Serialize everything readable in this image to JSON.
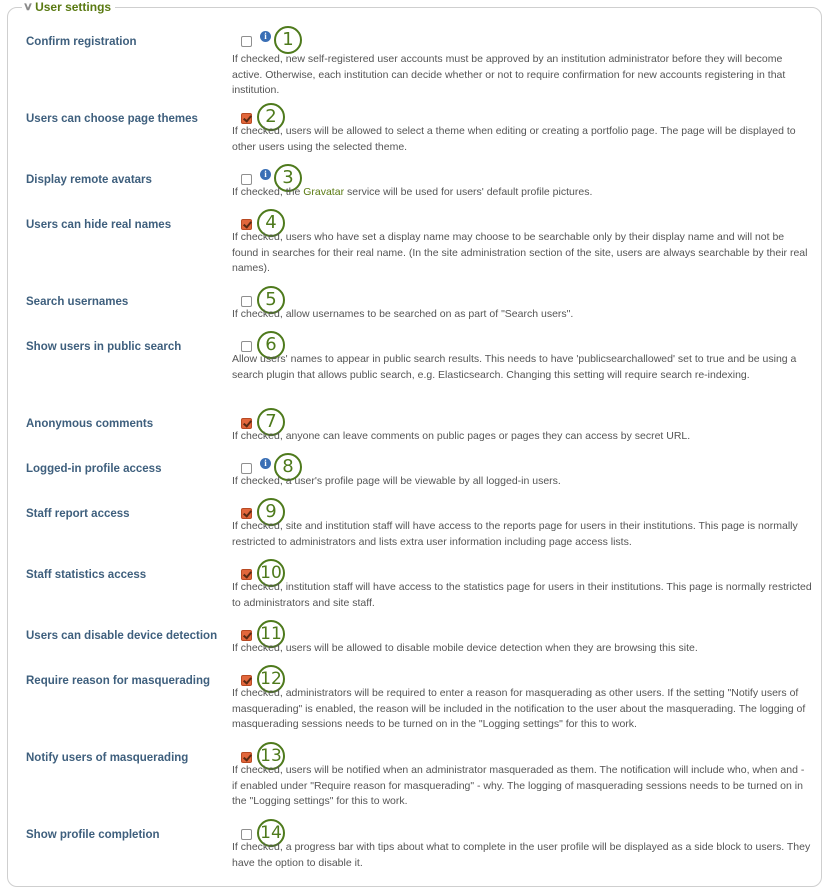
{
  "section": {
    "title": "User settings",
    "collapse_icon": "chevron-down-icon"
  },
  "settings": [
    {
      "label": "Confirm registration",
      "checked": false,
      "info": true,
      "callout": "1",
      "description": "If checked, new self-registered user accounts must be approved by an institution administrator before they will become active. Otherwise, each institution can decide whether or not to require confirmation for new accounts registering in that institution."
    },
    {
      "label": "Users can choose page themes",
      "checked": true,
      "info": false,
      "callout": "2",
      "description": "If checked, users will be allowed to select a theme when editing or creating a portfolio page. The page will be displayed to other users using the selected theme."
    },
    {
      "label": "Display remote avatars",
      "checked": false,
      "info": true,
      "callout": "3",
      "description_pre": "If checked, the ",
      "description_link": "Gravatar",
      "description_post": " service will be used for users' default profile pictures."
    },
    {
      "label": "Users can hide real names",
      "checked": true,
      "info": false,
      "callout": "4",
      "description": "If checked, users who have set a display name may choose to be searchable only by their display name and will not be found in searches for their real name. (In the site administration section of the site, users are always searchable by their real names)."
    },
    {
      "label": "Search usernames",
      "checked": false,
      "info": false,
      "callout": "5",
      "description": "If checked, allow usernames to be searched on as part of \"Search users\"."
    },
    {
      "label": "Show users in public search",
      "checked": false,
      "info": false,
      "callout": "6",
      "description": "Allow users' names to appear in public search results. This needs to have 'publicsearchallowed' set to true and be using a search plugin that allows public search, e.g. Elasticsearch. Changing this setting will require search re-indexing."
    },
    {
      "label": "Anonymous comments",
      "checked": true,
      "info": false,
      "callout": "7",
      "description": "If checked, anyone can leave comments on public pages or pages they can access by secret URL."
    },
    {
      "label": "Logged-in profile access",
      "checked": false,
      "info": true,
      "callout": "8",
      "description": "If checked, a user's profile page will be viewable by all logged-in users."
    },
    {
      "label": "Staff report access",
      "checked": true,
      "info": false,
      "callout": "9",
      "description": "If checked, site and institution staff will have access to the reports page for users in their institutions. This page is normally restricted to administrators and lists extra user information including page access lists."
    },
    {
      "label": "Staff statistics access",
      "checked": true,
      "info": false,
      "callout": "10",
      "description": "If checked, institution staff will have access to the statistics page for users in their institutions. This page is normally restricted to administrators and site staff."
    },
    {
      "label": "Users can disable device detection",
      "checked": true,
      "info": false,
      "callout": "11",
      "description": "If checked, users will be allowed to disable mobile device detection when they are browsing this site."
    },
    {
      "label": "Require reason for masquerading",
      "checked": true,
      "info": false,
      "callout": "12",
      "description": "If checked, administrators will be required to enter a reason for masquerading as other users. If the setting \"Notify users of masquerading\" is enabled, the reason will be included in the notification to the user about the masquerading. The logging of masquerading sessions needs to be turned on in the \"Logging settings\" for this to work."
    },
    {
      "label": "Notify users of masquerading",
      "checked": true,
      "info": false,
      "callout": "13",
      "description": "If checked, users will be notified when an administrator masqueraded as them. The notification will include who, when and - if enabled under \"Require reason for masquerading\" - why. The logging of masquerading sessions needs to be turned on in the \"Logging settings\" for this to work."
    },
    {
      "label": "Show profile completion",
      "checked": false,
      "info": false,
      "callout": "14",
      "description": "If checked, a progress bar with tips about what to complete in the user profile will be displayed as a side block to users. They have the option to disable it."
    }
  ],
  "colors": {
    "legend": "#5a7a12",
    "label": "#3e5f7d",
    "checkbox_checked": "#e2673c",
    "callout": "#4e7a1c",
    "info_icon": "#3a6fb5"
  }
}
